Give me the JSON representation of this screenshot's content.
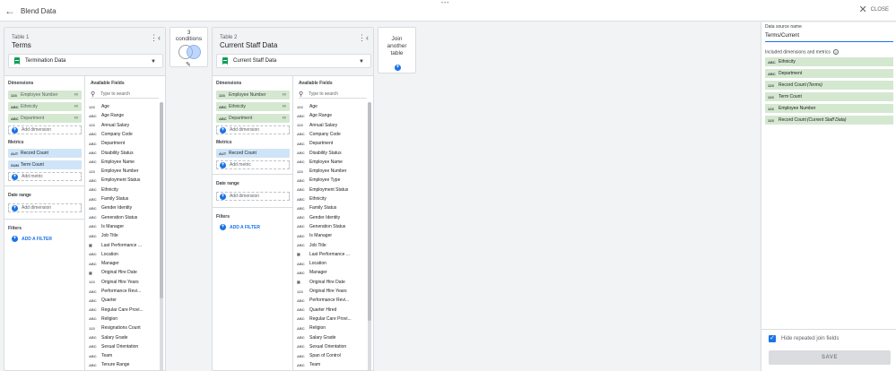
{
  "header": {
    "title": "Blend Data",
    "close_label": "CLOSE",
    "drag_handle": "•••"
  },
  "table1": {
    "subtitle": "Table 1",
    "name": "Terms",
    "source": "Termination Data",
    "dimensions_title": "Dimensions",
    "dimensions": [
      {
        "type": "123",
        "label": "Employee Number",
        "linked": true
      },
      {
        "type": "ABC",
        "label": "Ethnicity",
        "linked": true
      },
      {
        "type": "ABC",
        "label": "Department",
        "linked": true
      }
    ],
    "add_dimension": "Add dimension",
    "metrics_title": "Metrics",
    "metrics": [
      {
        "type": "AUT",
        "label": "Record Count"
      },
      {
        "type": "SUM",
        "label": "Term Count"
      }
    ],
    "add_metric": "Add metric",
    "date_range_title": "Date range",
    "date_range_add": "Add dimension",
    "filters_title": "Filters",
    "add_filter": "ADD A FILTER",
    "available_title": "Available Fields",
    "search_placeholder": "Type to search",
    "fields": [
      {
        "type": "123",
        "label": "Age"
      },
      {
        "type": "ABC",
        "label": "Age Range"
      },
      {
        "type": "123",
        "label": "Annual Salary"
      },
      {
        "type": "ABC",
        "label": "Company Code"
      },
      {
        "type": "ABC",
        "label": "Department"
      },
      {
        "type": "ABC",
        "label": "Disability Status"
      },
      {
        "type": "ABC",
        "label": "Employee Name"
      },
      {
        "type": "123",
        "label": "Employee Number"
      },
      {
        "type": "ABC",
        "label": "Employment Status"
      },
      {
        "type": "ABC",
        "label": "Ethnicity"
      },
      {
        "type": "ABC",
        "label": "Family Status"
      },
      {
        "type": "ABC",
        "label": "Gender Identity"
      },
      {
        "type": "ABC",
        "label": "Generation Status"
      },
      {
        "type": "ABC",
        "label": "Is Manager"
      },
      {
        "type": "ABC",
        "label": "Job Title"
      },
      {
        "type": "CAL",
        "label": "Last Performance ..."
      },
      {
        "type": "ABC",
        "label": "Location"
      },
      {
        "type": "ABC",
        "label": "Manager"
      },
      {
        "type": "CAL",
        "label": "Original Hire Date"
      },
      {
        "type": "123",
        "label": "Original Hire Years"
      },
      {
        "type": "ABC",
        "label": "Performance Revi..."
      },
      {
        "type": "ABC",
        "label": "Quarter"
      },
      {
        "type": "ABC",
        "label": "Regular Care Provi..."
      },
      {
        "type": "ABC",
        "label": "Religion"
      },
      {
        "type": "123",
        "label": "Resignations Count"
      },
      {
        "type": "ABC",
        "label": "Salary Grade"
      },
      {
        "type": "ABC",
        "label": "Sexual Orientation"
      },
      {
        "type": "ABC",
        "label": "Team"
      },
      {
        "type": "ABC",
        "label": "Tenure Range"
      }
    ]
  },
  "conditions": {
    "label": "3\nconditions"
  },
  "table2": {
    "subtitle": "Table 2",
    "name": "Current Staff Data",
    "source": "Current Staff Data",
    "dimensions_title": "Dimensions",
    "dimensions": [
      {
        "type": "123",
        "label": "Employee Number",
        "linked": true
      },
      {
        "type": "ABC",
        "label": "Ethnicity",
        "linked": true
      },
      {
        "type": "ABC",
        "label": "Department",
        "linked": true
      }
    ],
    "add_dimension": "Add dimension",
    "metrics_title": "Metrics",
    "metrics": [
      {
        "type": "AUT",
        "label": "Record Count"
      }
    ],
    "add_metric": "Add metric",
    "date_range_title": "Date range",
    "date_range_add": "Add dimension",
    "filters_title": "Filters",
    "add_filter": "ADD A FILTER",
    "available_title": "Available Fields",
    "search_placeholder": "Type to search",
    "fields": [
      {
        "type": "123",
        "label": "Age"
      },
      {
        "type": "ABC",
        "label": "Age Range"
      },
      {
        "type": "123",
        "label": "Annual Salary"
      },
      {
        "type": "ABC",
        "label": "Company Code"
      },
      {
        "type": "ABC",
        "label": "Department"
      },
      {
        "type": "ABC",
        "label": "Disability Status"
      },
      {
        "type": "ABC",
        "label": "Employee Name"
      },
      {
        "type": "123",
        "label": "Employee Number"
      },
      {
        "type": "ABC",
        "label": "Employee Type"
      },
      {
        "type": "ABC",
        "label": "Employment Status"
      },
      {
        "type": "ABC",
        "label": "Ethnicity"
      },
      {
        "type": "ABC",
        "label": "Family Status"
      },
      {
        "type": "ABC",
        "label": "Gender Identity"
      },
      {
        "type": "ABC",
        "label": "Generation Status"
      },
      {
        "type": "ABC",
        "label": "Is Manager"
      },
      {
        "type": "ABC",
        "label": "Job Title"
      },
      {
        "type": "CAL",
        "label": "Last Performance ..."
      },
      {
        "type": "ABC",
        "label": "Location"
      },
      {
        "type": "ABC",
        "label": "Manager"
      },
      {
        "type": "CAL",
        "label": "Original Hire Date"
      },
      {
        "type": "123",
        "label": "Original Hire Years"
      },
      {
        "type": "ABC",
        "label": "Performance Revi..."
      },
      {
        "type": "ABC",
        "label": "Quarter Hired"
      },
      {
        "type": "ABC",
        "label": "Regular Care Provi..."
      },
      {
        "type": "ABC",
        "label": "Religion"
      },
      {
        "type": "ABC",
        "label": "Salary Grade"
      },
      {
        "type": "ABC",
        "label": "Sexual Orientation"
      },
      {
        "type": "ABC",
        "label": "Span of Control"
      },
      {
        "type": "ABC",
        "label": "Team"
      }
    ]
  },
  "join": {
    "label": "Join\nanother\ntable"
  },
  "right_panel": {
    "name_label": "Data source name",
    "name_value": "Terms/Current",
    "included_label": "Included dimensions and metrics",
    "items": [
      {
        "type": "ABC",
        "label": "Ethnicity",
        "note": ""
      },
      {
        "type": "ABC",
        "label": "Department",
        "note": ""
      },
      {
        "type": "123",
        "label": "Record Count",
        "note": "(Terms)"
      },
      {
        "type": "123",
        "label": "Term Count",
        "note": ""
      },
      {
        "type": "123",
        "label": "Employee Number",
        "note": ""
      },
      {
        "type": "123",
        "label": "Record Count",
        "note": "(Current Staff Data)"
      }
    ],
    "hide_repeated_label": "Hide repeated join fields",
    "save_label": "SAVE"
  }
}
